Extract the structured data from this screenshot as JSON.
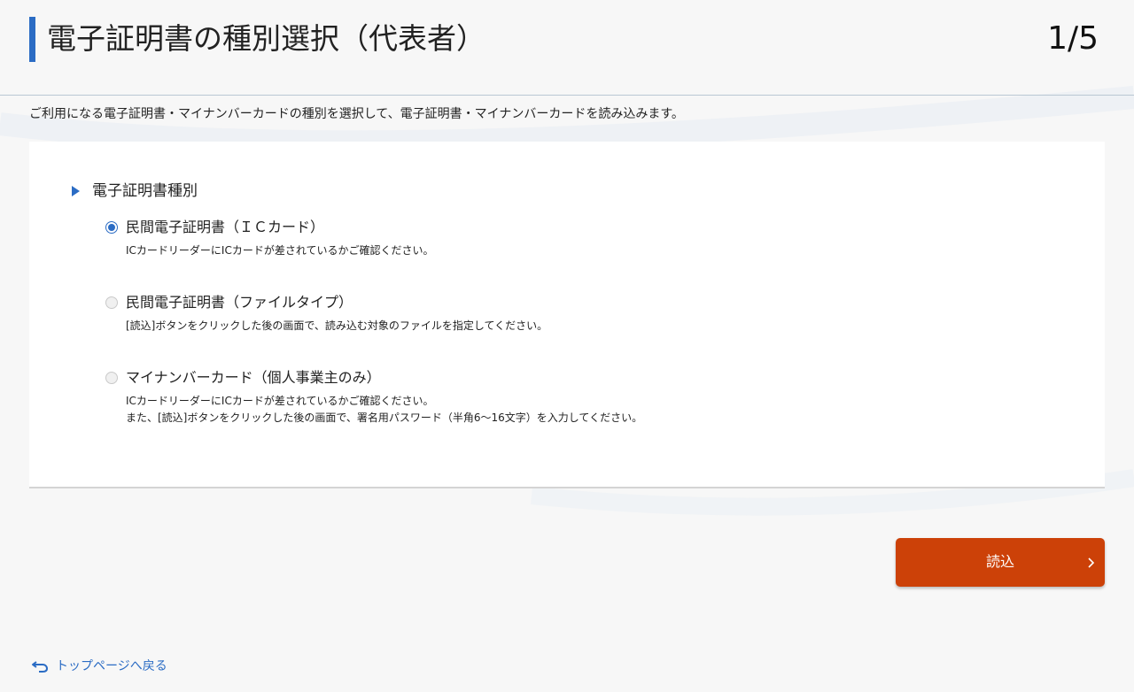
{
  "header": {
    "title": "電子証明書の種別選択（代表者）",
    "step": "1/5"
  },
  "intro": "ご利用になる電子証明書・マイナンバーカードの種別を選択して、電子証明書・マイナンバーカードを読み込みます。",
  "section": {
    "label": "電子証明書種別",
    "options": [
      {
        "label": "民間電子証明書（ＩＣカード）",
        "selected": true,
        "desc1": "ICカードリーダーにICカードが差されているかご確認ください。",
        "desc2": ""
      },
      {
        "label": "民間電子証明書（ファイルタイプ）",
        "selected": false,
        "desc1": "[読込]ボタンをクリックした後の画面で、読み込む対象のファイルを指定してください。",
        "desc2": ""
      },
      {
        "label": "マイナンバーカード（個人事業主のみ）",
        "selected": false,
        "desc1": "ICカードリーダーにICカードが差されているかご確認ください。",
        "desc2": "また、[読込]ボタンをクリックした後の画面で、署名用パスワード（半角6～16文字）を入力してください。"
      }
    ]
  },
  "read_button": {
    "label": "読込",
    "icon": "chevron-right-icon"
  },
  "back_link": {
    "label": "トップページへ戻る",
    "icon": "return-arrow-icon"
  },
  "colors": {
    "accent": "#2b6cc4",
    "primary_button": "#cc4108",
    "background": "#f7f7f7",
    "card": "#ffffff"
  }
}
